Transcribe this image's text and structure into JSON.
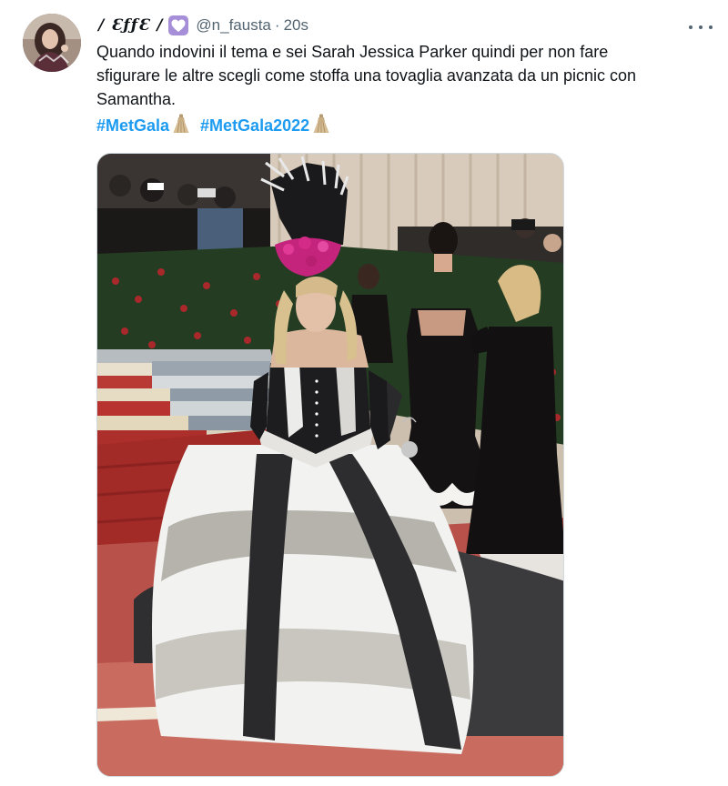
{
  "tweet": {
    "display_name": "/ ƐƒƒƐ /",
    "handle": "@n_fausta",
    "separator": "·",
    "timestamp": "20s",
    "text_lines": [
      "Quando indovini il tema e sei Sarah Jessica Parker quindi per non fare",
      "sfigurare le altre scegli come stoffa una tovaglia avanzata da un picnic con",
      "Samantha."
    ],
    "hashtags": [
      "#MetGala",
      "#MetGala2022"
    ],
    "icons": {
      "avatar": "profile-avatar",
      "badge": "purple-heart-icon",
      "more": "more-options-icon",
      "hashtag_emoji": "dress-icon"
    },
    "colors": {
      "link": "#1d9bf0",
      "secondary_text": "#536471",
      "badge": "#a68fd8"
    }
  }
}
